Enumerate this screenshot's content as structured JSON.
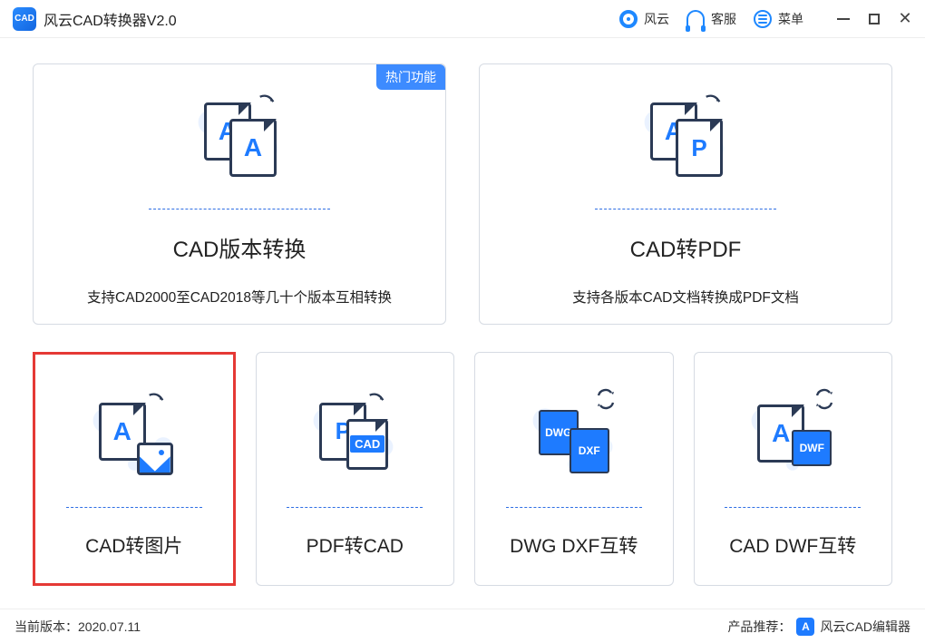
{
  "app": {
    "title": "风云CAD转换器V2.0",
    "logo_text": "CAD"
  },
  "titlebar": {
    "brand": "风云",
    "support": "客服",
    "menu": "菜单"
  },
  "badge": {
    "hot": "热门功能"
  },
  "cards": {
    "version": {
      "title": "CAD版本转换",
      "desc": "支持CAD2000至CAD2018等几十个版本互相转换"
    },
    "pdf": {
      "title": "CAD转PDF",
      "desc": "支持各版本CAD文档转换成PDF文档"
    },
    "image": {
      "title": "CAD转图片"
    },
    "pdf2cad": {
      "title": "PDF转CAD"
    },
    "dwgdxf": {
      "title": "DWG DXF互转"
    },
    "caddwf": {
      "title": "CAD DWF互转"
    }
  },
  "icons": {
    "dwg": "DWG",
    "dxf": "DXF",
    "dwf": "DWF",
    "cad": "CAD"
  },
  "footer": {
    "version_label": "当前版本：",
    "version_value": "2020.07.11",
    "recommend_label": "产品推荐：",
    "recommend_logo": "A",
    "recommend_name": "风云CAD编辑器"
  }
}
